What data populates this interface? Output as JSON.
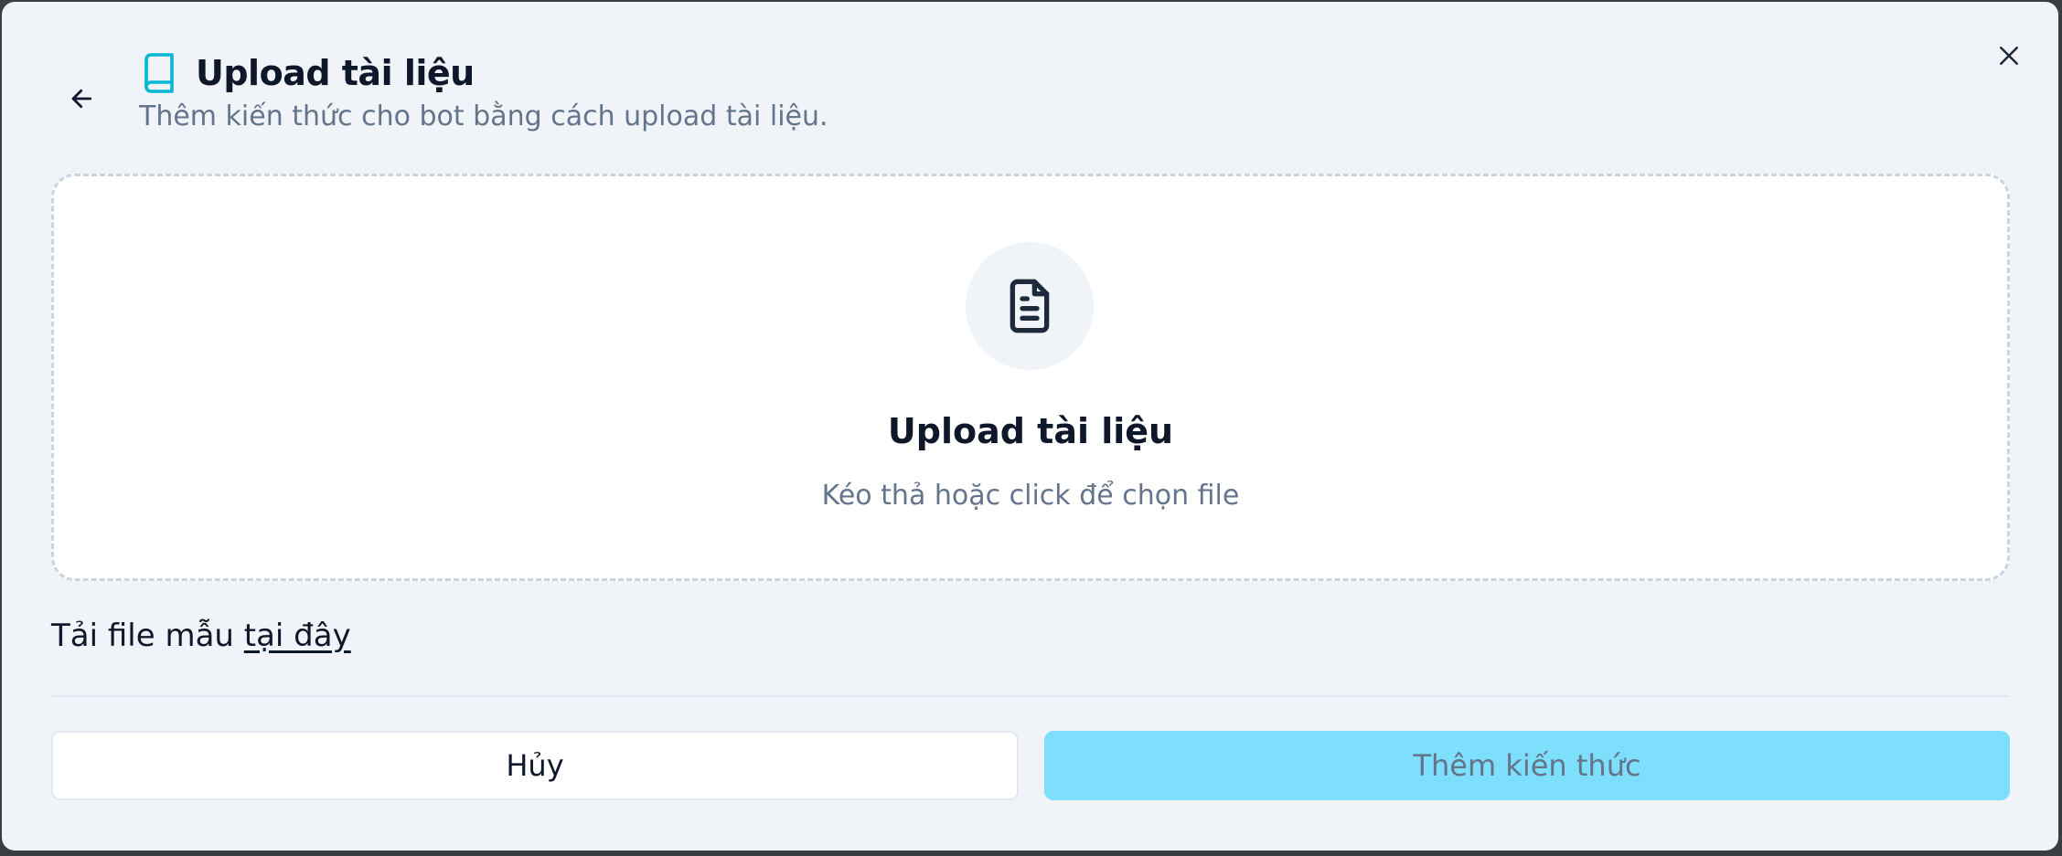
{
  "header": {
    "title": "Upload tài liệu",
    "subtitle": "Thêm kiến thức cho bot bằng cách upload tài liệu.",
    "title_icon": "book-icon",
    "back_icon": "arrow-left-icon",
    "close_icon": "close-icon"
  },
  "dropzone": {
    "icon": "file-text-icon",
    "title": "Upload tài liệu",
    "hint": "Kéo thả hoặc click để chọn file"
  },
  "template": {
    "prefix": "Tải file mẫu",
    "link_label": "tại đây"
  },
  "footer": {
    "cancel_label": "Hủy",
    "submit_label": "Thêm kiến thức"
  },
  "colors": {
    "accent": "#06b6d4",
    "submit_bg": "#7ddffb",
    "text_primary": "#0f172a",
    "text_muted": "#64748b"
  }
}
